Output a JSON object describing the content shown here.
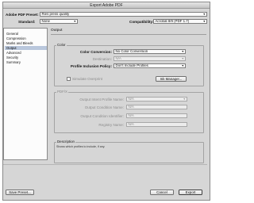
{
  "window": {
    "title": "Export Adobe PDF"
  },
  "top": {
    "preset_label": "Adobe PDF Preset:",
    "preset_value": "Ries press quality",
    "standard_label": "Standard:",
    "standard_value": "None",
    "compat_label": "Compatibility:",
    "compat_value": "Acrobat 8/9 (PDF 1.7)"
  },
  "sidebar": {
    "items": [
      {
        "label": "General"
      },
      {
        "label": "Compression"
      },
      {
        "label": "Marks and Bleeds"
      },
      {
        "label": "Output"
      },
      {
        "label": "Advanced"
      },
      {
        "label": "Security"
      },
      {
        "label": "Summary"
      }
    ],
    "selected": "Output"
  },
  "panel": {
    "title": "Output",
    "color": {
      "group_title": "Color",
      "conversion_label": "Color Conversion:",
      "conversion_value": "No Color Conversion",
      "destination_label": "Destination:",
      "destination_value": "N/A",
      "profile_label": "Profile Inclusion Policy:",
      "profile_value": "Don't Include Profiles",
      "simulate_label": "Simulate Overprint",
      "ink_manager_label": "Ink Manager..."
    },
    "pdfx": {
      "group_title": "PDF/X",
      "intent_label": "Output Intent Profile Name:",
      "intent_value": "N/A",
      "condition_name_label": "Output Condition Name:",
      "condition_name_value": "N/A",
      "condition_id_label": "Output Condition Identifier:",
      "condition_id_value": "N/A",
      "registry_label": "Registry Name:",
      "registry_value": "N/A"
    },
    "description": {
      "group_title": "Description",
      "text": "Shows which profiles to include, if any."
    }
  },
  "footer": {
    "save_preset_label": "Save Preset...",
    "cancel_label": "Cancel",
    "export_label": "Export"
  },
  "icons": {
    "dropdown": "chevron-down-icon"
  }
}
